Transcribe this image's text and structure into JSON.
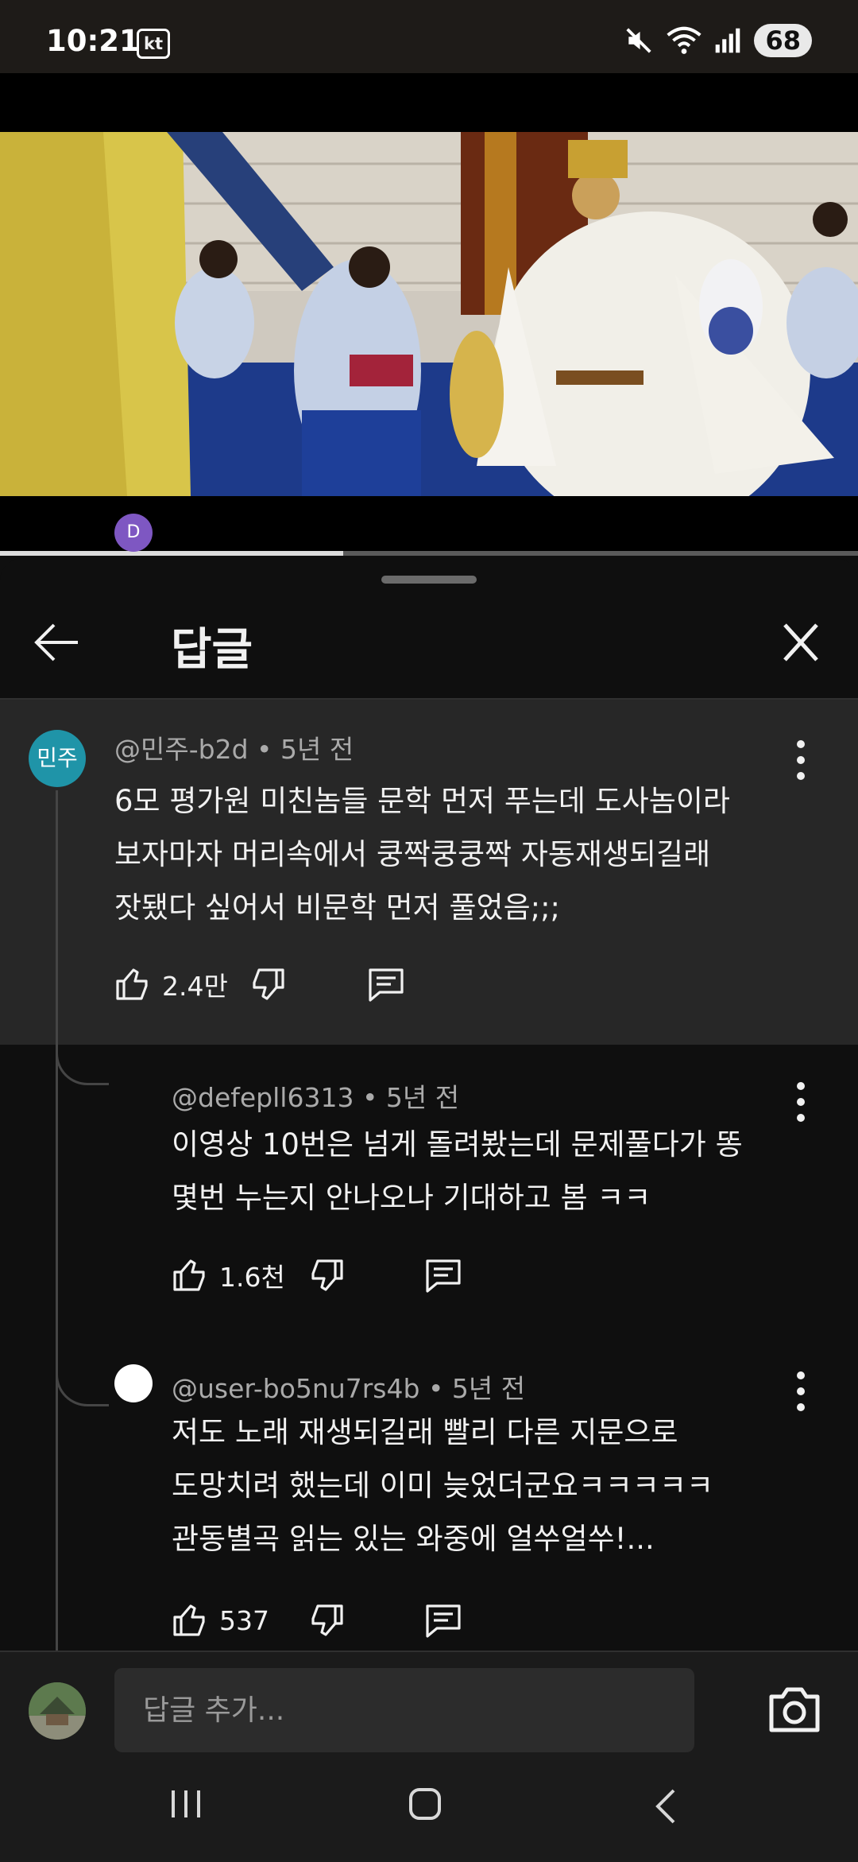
{
  "status_bar": {
    "time": "10:21",
    "carrier": "kt",
    "battery": "68"
  },
  "video": {
    "progress_percent": 40
  },
  "sheet": {
    "title": "답글"
  },
  "comments": [
    {
      "author": "@민주-b2d",
      "time": "5년 전",
      "avatar_text": "민주",
      "avatar_color": "#1f94a8",
      "lines": [
        "6모 평가원 미친놈들 문학 먼저 푸는데 도사놈이라",
        "보자마자 머리속에서 쿵짝쿵쿵짝 자동재생되길래",
        "잣됐다 싶어서 비문학 먼저 풀었음;;;"
      ],
      "likes": "2.4만"
    },
    {
      "author": "@defepll6313",
      "time": "5년 전",
      "avatar_text": "D",
      "avatar_color": "#7e57c2",
      "lines": [
        "이영상 10번은 넘게 돌려봤는데 문제풀다가 똥",
        "몇번 누는지 안나오나 기대하고 봄 ㅋㅋ"
      ],
      "likes": "1.6천"
    },
    {
      "author": "@user-bo5nu7rs4b",
      "time": "5년 전",
      "avatar_text": "",
      "avatar_color": "#ffffff",
      "lines": [
        "저도 노래 재생되길래 빨리 다른 지문으로",
        "도망치려 했는데 이미 늦었더군요ㅋㅋㅋㅋㅋ",
        "관동별곡 읽는 있는 와중에 얼쑤얼쑤!..."
      ],
      "likes": "537"
    }
  ],
  "reply_bar": {
    "placeholder": "답글 추가..."
  },
  "icons": [
    "back-arrow-icon",
    "close-icon",
    "more-vert-icon",
    "thumbs-up-icon",
    "thumbs-down-icon",
    "reply-icon",
    "camera-icon",
    "nav-recent-icon",
    "nav-home-icon",
    "nav-back-icon",
    "mute-icon",
    "wifi-icon",
    "signal-icon"
  ]
}
